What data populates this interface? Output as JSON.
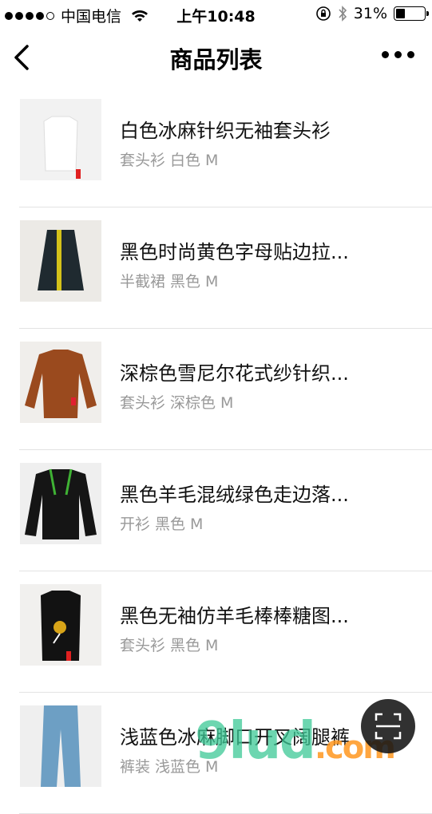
{
  "status_bar": {
    "carrier": "中国电信",
    "time": "上午10:48",
    "battery": "31%",
    "battery_level": 0.31,
    "signal_bars": 4,
    "signal_total": 5
  },
  "nav": {
    "title": "商品列表",
    "back_icon": "chevron-left-icon",
    "more_icon": "more-dots-icon"
  },
  "products": [
    {
      "title": "白色冰麻针织无袖套头衫",
      "category": "套头衫",
      "color": "白色",
      "size": "M",
      "thumb_bg": "#f2f2f2",
      "garment_color": "#ffffff"
    },
    {
      "title": "黑色时尚黄色字母贴边拉...",
      "category": "半截裙",
      "color": "黑色",
      "size": "M",
      "thumb_bg": "#eceae6",
      "garment_color": "#1f2a30"
    },
    {
      "title": "深棕色雪尼尔花式纱针织...",
      "category": "套头衫",
      "color": "深棕色",
      "size": "M",
      "thumb_bg": "#f0eeeb",
      "garment_color": "#9a4a1e"
    },
    {
      "title": "黑色羊毛混绒绿色走边落...",
      "category": "开衫",
      "color": "黑色",
      "size": "M",
      "thumb_bg": "#efefef",
      "garment_color": "#151515"
    },
    {
      "title": "黑色无袖仿羊毛棒棒糖图...",
      "category": "套头衫",
      "color": "黑色",
      "size": "M",
      "thumb_bg": "#f1f0ee",
      "garment_color": "#121212"
    },
    {
      "title": "浅蓝色冰麻脚口开叉阔腿裤",
      "category": "裤装",
      "color": "浅蓝色",
      "size": "M",
      "thumb_bg": "#efefef",
      "garment_color": "#6d9fc4"
    }
  ],
  "floating_button": {
    "icon": "scan-icon"
  },
  "watermark": {
    "text": "9lud",
    "suffix": ".com"
  }
}
